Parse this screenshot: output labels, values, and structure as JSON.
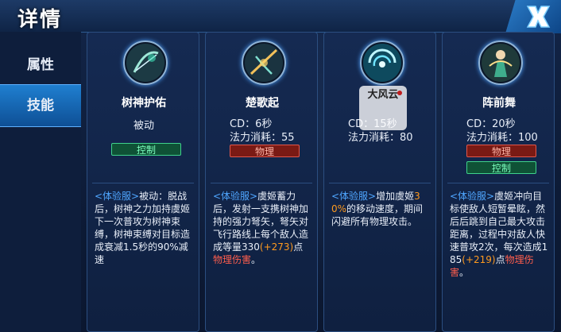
{
  "header": {
    "title": "详情"
  },
  "sidebar": {
    "tabs": [
      {
        "label": "属性",
        "active": false
      },
      {
        "label": "技能",
        "active": true
      }
    ]
  },
  "tags": {
    "control": "控制",
    "physical": "物理"
  },
  "skills": [
    {
      "name": "树神护佑",
      "type": "被动",
      "icon": "bow-icon",
      "tags": [
        "控制"
      ],
      "desc_prefix": "<体验服>",
      "desc_text": "被动：脱战后，树神之力加持虞姬下一次普攻为树神束缚，树神束缚对目标造成衰减1.5秒的90%减速"
    },
    {
      "name": "楚歌起",
      "cd": "CD：6秒",
      "mana": "法力消耗：55",
      "icon": "crossbow-icon",
      "tags": [
        "物理"
      ],
      "desc_prefix": "<体验服>",
      "desc_text": "虞姬蓄力后，发射一支携树神加持的强力弩矢，弩矢对飞行路线上每个敌人造成等量330",
      "desc_bonus": "(+273)",
      "desc_point": "点",
      "desc_damage": "物理伤害",
      "desc_end": "。"
    },
    {
      "name": "",
      "cd": "CD：15秒",
      "mana": "法力消耗：80",
      "icon": "whirlwind-icon",
      "tags": [],
      "desc_prefix": "<体验服>",
      "desc_text_a": "增加虞姬",
      "desc_pct": "30%",
      "desc_text_b": "的移动速度，期间闪避所有物理攻击。"
    },
    {
      "name": "阵前舞",
      "cd": "CD：20秒",
      "mana": "法力消耗：100",
      "icon": "archer-icon",
      "tags": [
        "物理",
        "控制"
      ],
      "desc_prefix": "<体验服>",
      "desc_text": "虞姬冲向目标使敌人短暂晕眩，然后后跳到自己最大攻击距离，过程中对敌人快速普攻2次，每次造成185",
      "desc_bonus": "(+219)",
      "desc_point": "点",
      "desc_damage": "物理伤害",
      "desc_end": "。"
    }
  ],
  "watermark": {
    "text": "大风云"
  },
  "colors": {
    "accent": "#1f7fd0",
    "highlight_blue": "#4fa6ff",
    "highlight_orange": "#ff9a1f",
    "damage_red": "#ff5e4d",
    "control_green": "#3fd28c"
  }
}
